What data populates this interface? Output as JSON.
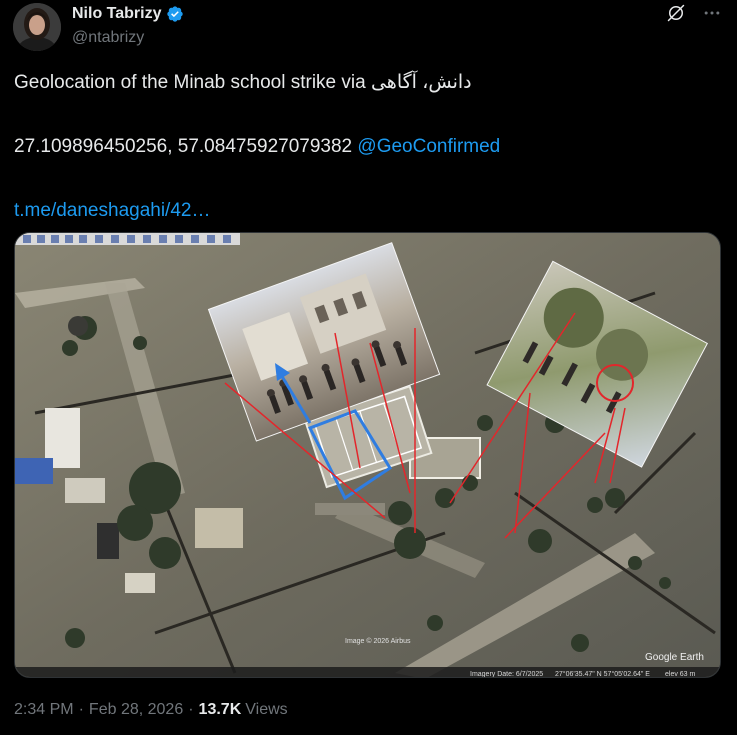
{
  "author": {
    "display_name": "Nilo Tabrizy",
    "handle": "@ntabrizy",
    "verified": true
  },
  "icons": {
    "verified": "verified-badge-icon",
    "grok": "grok-icon",
    "more": "more-options-icon"
  },
  "tweet": {
    "line1_prefix": "Geolocation of the Minab school strike via ",
    "line1_persian": "دانش، آگاهی",
    "coordinates": "27.109896450256, 57.08475927079382 ",
    "mention": "@GeoConfirmed",
    "link": "t.me/daneshagahi/42…"
  },
  "media": {
    "watermark_imagery": "Image © 2026 Airbus",
    "watermark_brand": "Google Earth",
    "status_bar_date": "Imagery Date: 6/7/2025",
    "status_bar_coords": "27°06'35.47\" N   57°05'02.64\" E",
    "status_bar_elev": "elev 63 m"
  },
  "footer": {
    "time": "2:34 PM",
    "separator": "·",
    "date": "Feb 28, 2026",
    "views_count": "13.7K",
    "views_label": "Views"
  },
  "colors": {
    "background": "#000000",
    "text_primary": "#e7e9ea",
    "text_secondary": "#71767b",
    "link": "#1d9bf0",
    "verified": "#1d9bf0",
    "annotation_red": "#e3262b",
    "annotation_blue": "#2f7de1"
  }
}
